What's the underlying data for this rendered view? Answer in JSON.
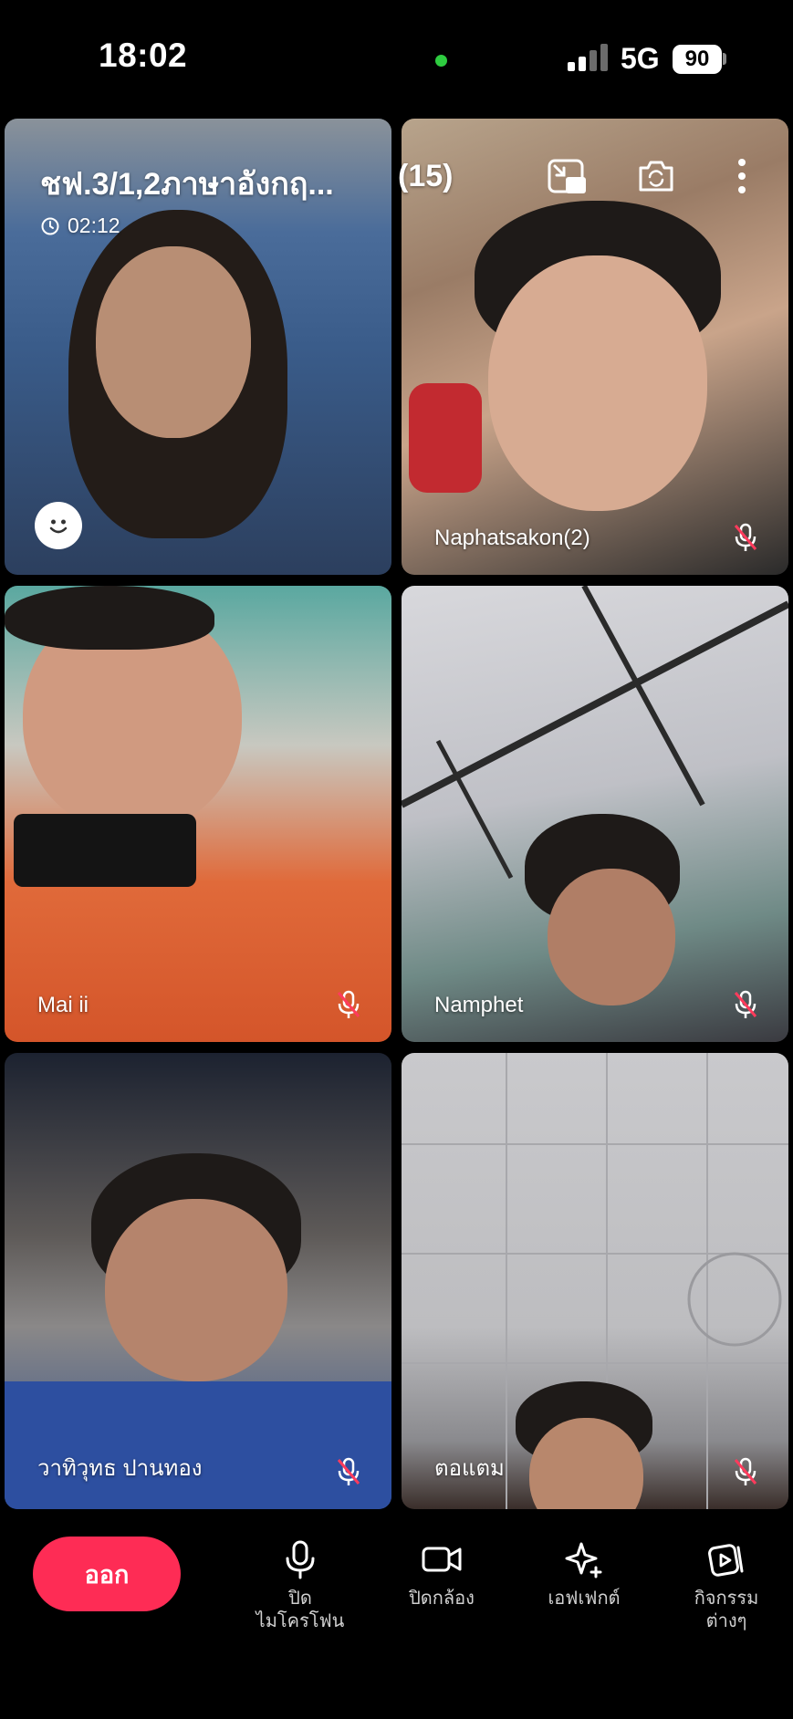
{
  "status_bar": {
    "time": "18:02",
    "network": "5G",
    "battery": "90",
    "colors": {
      "camera_indicator": "#2ecc40"
    }
  },
  "meeting": {
    "title": "ชฟ.3/1,2ภาษาอังกฤ...",
    "participant_count": "(15)",
    "duration": "02:12"
  },
  "top_controls": {
    "icons": [
      "pip-minimize-icon",
      "switch-camera-icon",
      "more-options-icon"
    ]
  },
  "participants": [
    {
      "name": "",
      "muted": false,
      "self": true
    },
    {
      "name": "Naphatsakon(2)",
      "muted": true
    },
    {
      "name": "Mai ii",
      "muted": true
    },
    {
      "name": "Namphet",
      "muted": true
    },
    {
      "name": "วาทิวุทธ  ปานทอง",
      "muted": true
    },
    {
      "name": "ตอแตม",
      "muted": true
    }
  ],
  "bottom_bar": {
    "leave_label": "ออก",
    "leave_color": "#fe2c55",
    "tools": [
      {
        "icon": "microphone-icon",
        "label": "ปิด\nไมโครโฟน"
      },
      {
        "icon": "video-camera-icon",
        "label": "ปิดกล้อง"
      },
      {
        "icon": "effects-sparkle-icon",
        "label": "เอฟเฟกต์"
      },
      {
        "icon": "activities-icon",
        "label": "กิจกรรม\nต่างๆ"
      }
    ]
  }
}
